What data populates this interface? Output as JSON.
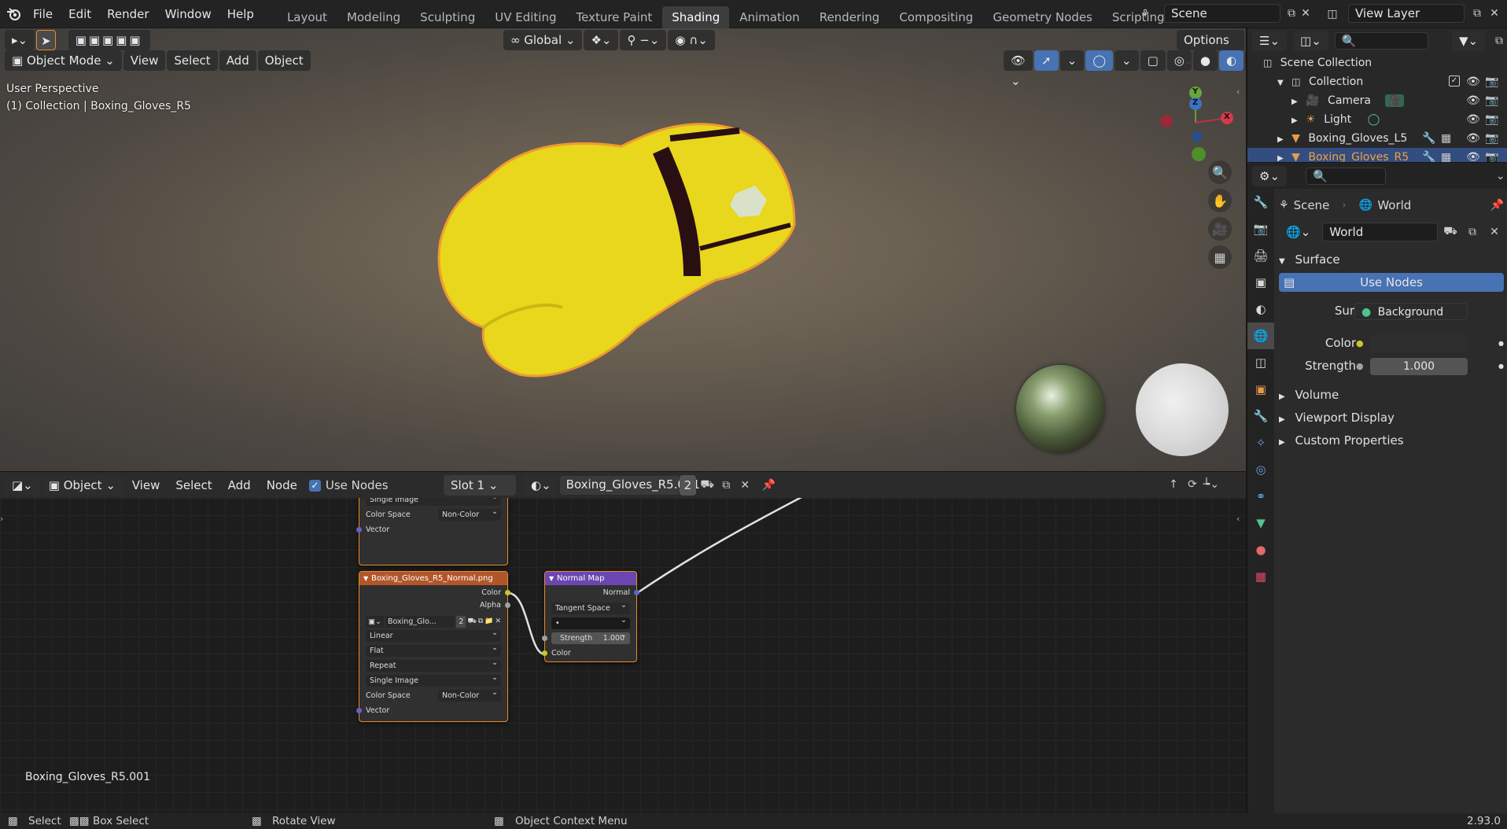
{
  "topbar": {
    "menus": [
      "File",
      "Edit",
      "Render",
      "Window",
      "Help"
    ],
    "workspaces": [
      "Layout",
      "Modeling",
      "Sculpting",
      "UV Editing",
      "Texture Paint",
      "Shading",
      "Animation",
      "Rendering",
      "Compositing",
      "Geometry Nodes",
      "Scripting"
    ],
    "active_workspace": "Shading",
    "scene_label": "Scene",
    "view_layer_label": "View Layer"
  },
  "viewport": {
    "mode_label": "Object Mode",
    "menus": [
      "View",
      "Select",
      "Add",
      "Object"
    ],
    "transform_orientation": "Global",
    "options_label": "Options",
    "perspective_text": "User Perspective",
    "collection_text": "(1) Collection | Boxing_Gloves_R5",
    "gizmo": {
      "x": "X",
      "y": "Y",
      "z": "Z"
    }
  },
  "node_editor": {
    "editor_type": "Object",
    "menus": [
      "View",
      "Select",
      "Add",
      "Node"
    ],
    "use_nodes_label": "Use Nodes",
    "use_nodes_checked": true,
    "slot_label": "Slot 1",
    "material_name": "Boxing_Gloves_R5.001",
    "user_count": "2",
    "footer_name": "Boxing_Gloves_R5.001",
    "top_node": {
      "dropdown": "Single Image",
      "color_space_label": "Color Space",
      "color_space_value": "Non-Color",
      "vector_label": "Vector"
    },
    "image_node": {
      "title": "Boxing_Gloves_R5_Normal.png",
      "out_color": "Color",
      "out_alpha": "Alpha",
      "image_name": "Boxing_Glo...",
      "image_users": "2",
      "interpolation": "Linear",
      "projection": "Flat",
      "extension": "Repeat",
      "source": "Single Image",
      "color_space_label": "Color Space",
      "color_space_value": "Non-Color",
      "vector_label": "Vector"
    },
    "normal_map_node": {
      "title": "Normal Map",
      "out_normal": "Normal",
      "space": "Tangent Space",
      "uv_value": "•",
      "strength_label": "Strength",
      "strength_value": "1.000",
      "in_color": "Color"
    }
  },
  "outliner": {
    "root": "Scene Collection",
    "items": [
      {
        "name": "Collection",
        "level": 1
      },
      {
        "name": "Camera",
        "level": 2
      },
      {
        "name": "Light",
        "level": 2
      },
      {
        "name": "Boxing_Gloves_L5",
        "level": 1
      },
      {
        "name": "Boxing_Gloves_R5",
        "level": 1,
        "selected": true
      }
    ]
  },
  "properties": {
    "breadcrumb_scene": "Scene",
    "breadcrumb_world": "World",
    "world_name": "World",
    "surface_panel": "Surface",
    "use_nodes_button": "Use Nodes",
    "surface_label": "Surface",
    "surface_value": "Background",
    "color_label": "Color",
    "strength_label": "Strength",
    "strength_value": "1.000",
    "panels": [
      "Volume",
      "Viewport Display",
      "Custom Properties"
    ]
  },
  "statusbar": {
    "select": "Select",
    "box_select": "Box Select",
    "rotate_view": "Rotate View",
    "context_menu": "Object Context Menu",
    "version": "2.93.0"
  },
  "colors": {
    "accent_blue": "#4772b3",
    "selection_orange": "#e88a2e",
    "glove_yellow": "#e8d71c",
    "image_node_header": "#b2562a",
    "normal_node_header": "#6c46b0"
  }
}
